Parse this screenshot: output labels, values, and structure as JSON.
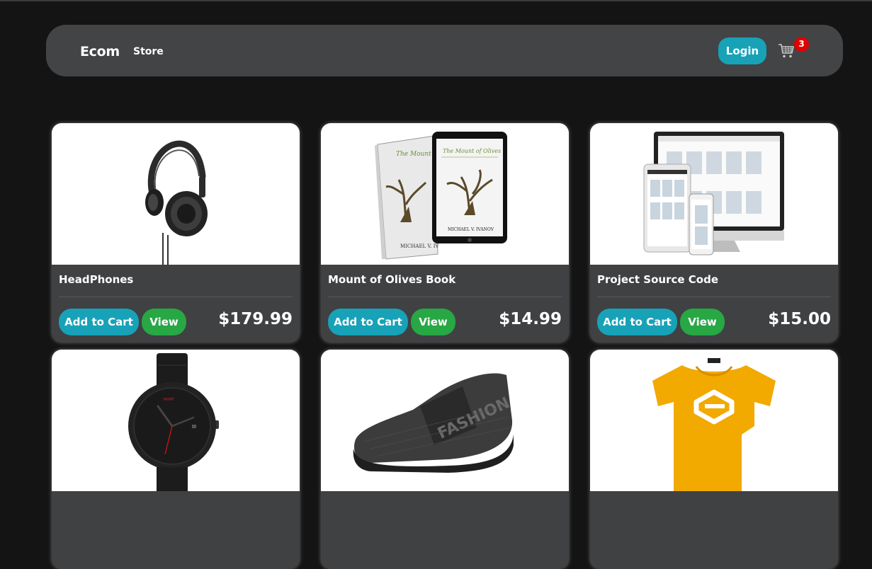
{
  "navbar": {
    "brand": "Ecom",
    "store_link": "Store",
    "login_label": "Login",
    "cart_count": "3",
    "cart_icon": "shopping-cart-icon"
  },
  "colors": {
    "page_bg": "#141414",
    "navbar_bg": "#434445",
    "card_body_bg": "#404142",
    "primary": "#17a2b8",
    "success": "#28a745",
    "badge": "#e00000"
  },
  "products": [
    {
      "name": "HeadPhones",
      "price": "$179.99",
      "add_label": "Add to Cart",
      "view_label": "View",
      "image": "headphones-image"
    },
    {
      "name": "Mount of Olives Book",
      "price": "$14.99",
      "add_label": "Add to Cart",
      "view_label": "View",
      "image": "book-and-tablet-image",
      "image_text": {
        "cover_title": "The Mount of Olives",
        "author": "MICHAEL V. IVANOV"
      }
    },
    {
      "name": "Project Source Code",
      "price": "$15.00",
      "add_label": "Add to Cart",
      "view_label": "View",
      "image": "devices-mockup-image"
    },
    {
      "name": "",
      "price": "",
      "add_label": "",
      "view_label": "",
      "image": "wristwatch-image"
    },
    {
      "name": "",
      "price": "",
      "add_label": "",
      "view_label": "",
      "image": "sneaker-image",
      "image_text": {
        "brand_print": "FASHION"
      }
    },
    {
      "name": "",
      "price": "",
      "add_label": "",
      "view_label": "",
      "image": "yellow-tshirt-image"
    }
  ]
}
